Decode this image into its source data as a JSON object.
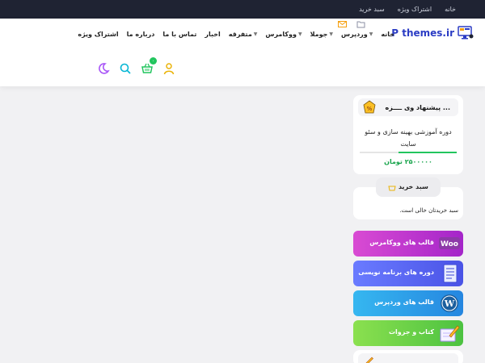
{
  "topbar": {
    "links": [
      "خانه",
      "اشتراک ویژه",
      "سبد خرید"
    ]
  },
  "logo": {
    "text": "P themes.ir"
  },
  "nav": {
    "items": [
      {
        "label": "خانه",
        "caret": false
      },
      {
        "label": "وردپرس",
        "caret": true
      },
      {
        "label": "جوملا",
        "caret": true
      },
      {
        "label": "ووکامرس",
        "caret": true
      },
      {
        "label": "متفرقه",
        "caret": true
      },
      {
        "label": "اخبار",
        "caret": false
      },
      {
        "label": "تماس با ما",
        "caret": false
      },
      {
        "label": "درباره ما",
        "caret": false
      },
      {
        "label": "اشتراک ویژه",
        "caret": false
      }
    ]
  },
  "header": {
    "cart_count": "۰"
  },
  "offer": {
    "title": "پیشنهاد وی ــــزه ...",
    "course": "دوره آموزشی بهینه سازی و سئو سایت",
    "price": "۲۵۰۰۰۰۰ تومان",
    "progress": 0.6
  },
  "basket": {
    "title": "سبد خرید",
    "empty": "سبد خریدتان خالی است."
  },
  "categories": [
    {
      "label": "قالب های ووکامرس"
    },
    {
      "label": "دوره های برنامه نویسی"
    },
    {
      "label": "قالب های وردپرس"
    },
    {
      "label": "کتاب و جزوات"
    }
  ],
  "colors": {
    "topbar": "#1f2333",
    "accent_green": "#22c55e",
    "logo_blue": "#2b3cc4",
    "icon_purple": "#a855f7",
    "icon_teal": "#06b6d4"
  }
}
